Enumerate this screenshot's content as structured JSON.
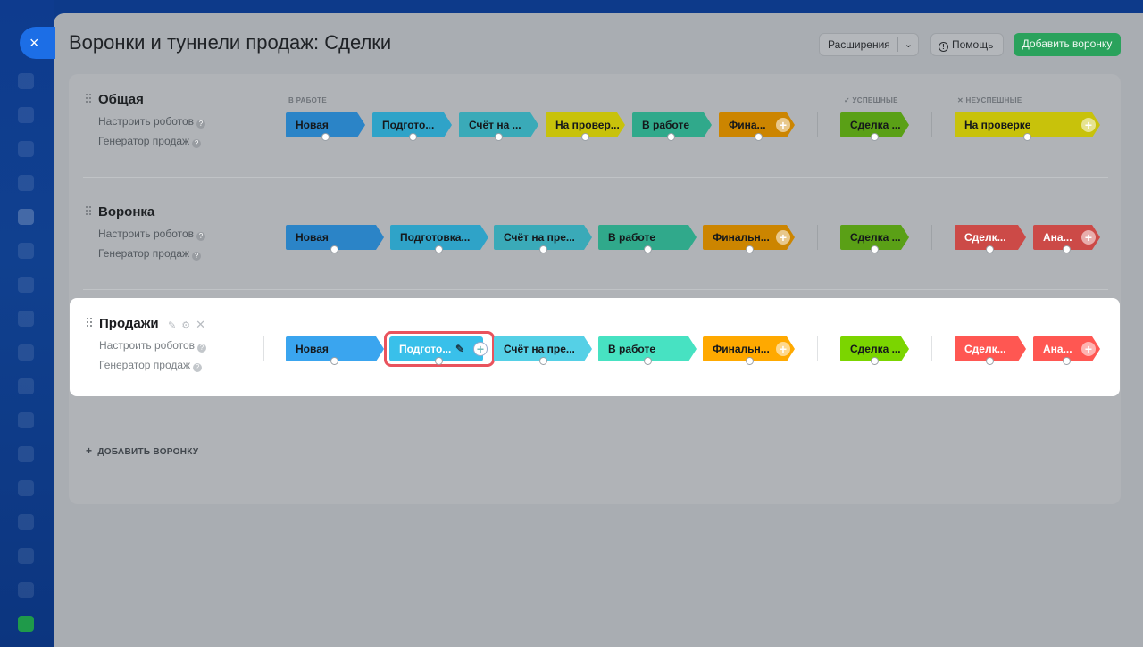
{
  "panel": {
    "title": "Воронки и туннели продаж: Сделки",
    "close_icon": "×",
    "extensions_label": "Расширения",
    "help_label": "Помощь",
    "add_funnel_button": "Добавить воронку"
  },
  "headers": {
    "in_progress": "В РАБОТЕ",
    "success": "УСПЕШНЫЕ",
    "failure": "НЕУСПЕШНЫЕ"
  },
  "links": {
    "robots": "Настроить роботов",
    "generator": "Генератор продаж"
  },
  "funnels": [
    {
      "name": "Общая",
      "stages": [
        "Новая",
        "Подгото...",
        "Счёт на ...",
        "На провер...",
        "В работе",
        "Фина..."
      ],
      "success": [
        "Сделка ..."
      ],
      "fail": [
        "На проверке"
      ]
    },
    {
      "name": "Воронка",
      "stages": [
        "Новая",
        "Подготовка...",
        "Счёт на пре...",
        "В работе",
        "Финальн..."
      ],
      "success": [
        "Сделка ..."
      ],
      "fail": [
        "Сделк...",
        "Ана..."
      ]
    },
    {
      "name": "Продажи",
      "stages": [
        "Новая",
        "Подгото...",
        "Счёт на пре...",
        "В работе",
        "Финальн..."
      ],
      "success": [
        "Сделка ..."
      ],
      "fail": [
        "Сделк...",
        "Ана..."
      ]
    }
  ],
  "add_funnel_link": "ДОБАВИТЬ ВОРОНКУ",
  "colors": {
    "accent_green": "#2aa25c",
    "selection_red": "#e9535d",
    "active_blue": "#39c0ea"
  }
}
